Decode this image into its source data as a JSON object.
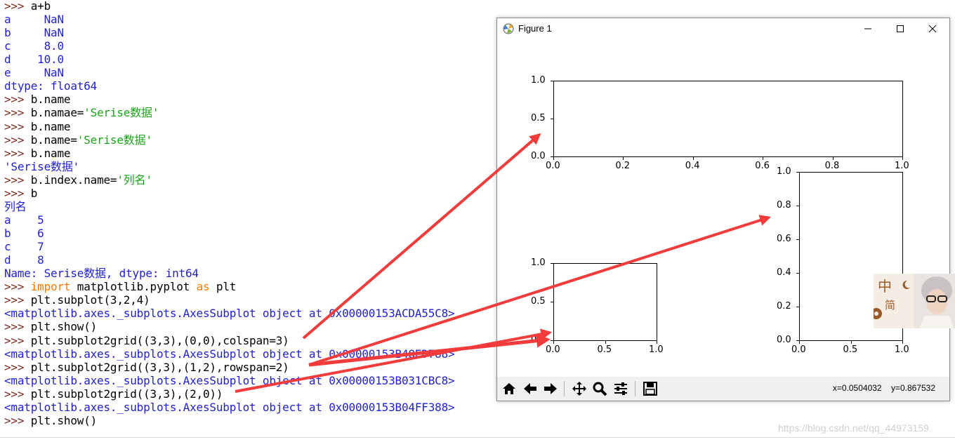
{
  "console": {
    "prompt": ">>>",
    "lines": [
      {
        "type": "cmd",
        "text": "a+b"
      },
      {
        "type": "out",
        "text": "a     NaN"
      },
      {
        "type": "out",
        "text": "b     NaN"
      },
      {
        "type": "out",
        "text": "c     8.0"
      },
      {
        "type": "out",
        "text": "d    10.0"
      },
      {
        "type": "out",
        "text": "e     NaN"
      },
      {
        "type": "out",
        "text": "dtype: float64"
      },
      {
        "type": "cmd",
        "text": "b.name"
      },
      {
        "type": "cmd",
        "parts": [
          {
            "c": "cmd",
            "t": "b.namae="
          },
          {
            "c": "str",
            "t": "'Serise数据'"
          }
        ]
      },
      {
        "type": "cmd",
        "text": "b.name"
      },
      {
        "type": "cmd",
        "parts": [
          {
            "c": "cmd",
            "t": "b.name="
          },
          {
            "c": "str",
            "t": "'Serise数据'"
          }
        ]
      },
      {
        "type": "cmd",
        "text": "b.name"
      },
      {
        "type": "out",
        "text": "'Serise数据'"
      },
      {
        "type": "cmd",
        "parts": [
          {
            "c": "cmd",
            "t": "b.index.name="
          },
          {
            "c": "str",
            "t": "'列名'"
          }
        ]
      },
      {
        "type": "cmd",
        "text": "b"
      },
      {
        "type": "out",
        "text": "列名"
      },
      {
        "type": "out",
        "text": "a    5"
      },
      {
        "type": "out",
        "text": "b    6"
      },
      {
        "type": "out",
        "text": "c    7"
      },
      {
        "type": "out",
        "text": "d    8"
      },
      {
        "type": "out",
        "text": "Name: Serise数据, dtype: int64"
      },
      {
        "type": "cmd",
        "parts": [
          {
            "c": "kw",
            "t": "import"
          },
          {
            "c": "cmd",
            "t": " matplotlib.pyplot "
          },
          {
            "c": "kw",
            "t": "as"
          },
          {
            "c": "cmd",
            "t": " plt"
          }
        ]
      },
      {
        "type": "cmd",
        "text": "plt.subplot(3,2,4)"
      },
      {
        "type": "out",
        "text": "<matplotlib.axes._subplots.AxesSubplot object at 0x00000153ACDA55C8>"
      },
      {
        "type": "cmd",
        "text": "plt.show()"
      },
      {
        "type": "cmd",
        "text": "plt.subplot2grid((3,3),(0,0),colspan=3)"
      },
      {
        "type": "out",
        "text": "<matplotlib.axes._subplots.AxesSubplot object at 0x00000153B48ED788>"
      },
      {
        "type": "cmd",
        "text": "plt.subplot2grid((3,3),(1,2),rowspan=2)"
      },
      {
        "type": "out",
        "text": "<matplotlib.axes._subplots.AxesSubplot object at 0x00000153B031CBC8>"
      },
      {
        "type": "cmd",
        "text": "plt.subplot2grid((3,3),(2,0))"
      },
      {
        "type": "out",
        "text": "<matplotlib.axes._subplots.AxesSubplot object at 0x00000153B04FF388>"
      },
      {
        "type": "cmd",
        "text": "plt.show()"
      }
    ]
  },
  "figure_window": {
    "title": "Figure 1",
    "minimize_icon": "minimize-icon",
    "maximize_icon": "maximize-icon",
    "close_icon": "close-icon",
    "status": {
      "x": "x=0.0504032",
      "y": "y=0.867532"
    },
    "toolbar": [
      "home-icon",
      "back-arrow-icon",
      "forward-arrow-icon",
      "pan-icon",
      "zoom-icon",
      "configure-subplots-icon",
      "save-icon"
    ]
  },
  "chart_data": [
    {
      "type": "scatter",
      "title": "",
      "xlim": [
        0,
        1
      ],
      "ylim": [
        0,
        1
      ],
      "xticks": [
        "0.0",
        "0.2",
        "0.4",
        "0.6",
        "0.8",
        "1.0"
      ],
      "yticks": [
        "0.0",
        "0.5",
        "1.0"
      ],
      "x": [],
      "y": []
    },
    {
      "type": "scatter",
      "title": "",
      "xlim": [
        0,
        1
      ],
      "ylim": [
        0,
        1
      ],
      "xticks": [
        "0.0",
        "0.5",
        "1.0"
      ],
      "yticks": [
        "0.0",
        "0.2",
        "0.4",
        "0.6",
        "0.8",
        "1.0"
      ],
      "x": [],
      "y": []
    },
    {
      "type": "scatter",
      "title": "",
      "xlim": [
        0,
        1
      ],
      "ylim": [
        0,
        1
      ],
      "xticks": [
        "0.0",
        "0.5",
        "1.0"
      ],
      "yticks": [
        "0.0",
        "0.5",
        "1.0"
      ],
      "x": [],
      "y": []
    }
  ],
  "ime": {
    "mode": "中",
    "variant": "简",
    "icon": "gear-icon"
  },
  "watermark": "https://blog.csdn.net/qq_44973159",
  "colors": {
    "annotation_arrow": "#f23c3c",
    "output": "#1f1fd6",
    "string": "#18a618",
    "keyword": "#ff7700"
  }
}
